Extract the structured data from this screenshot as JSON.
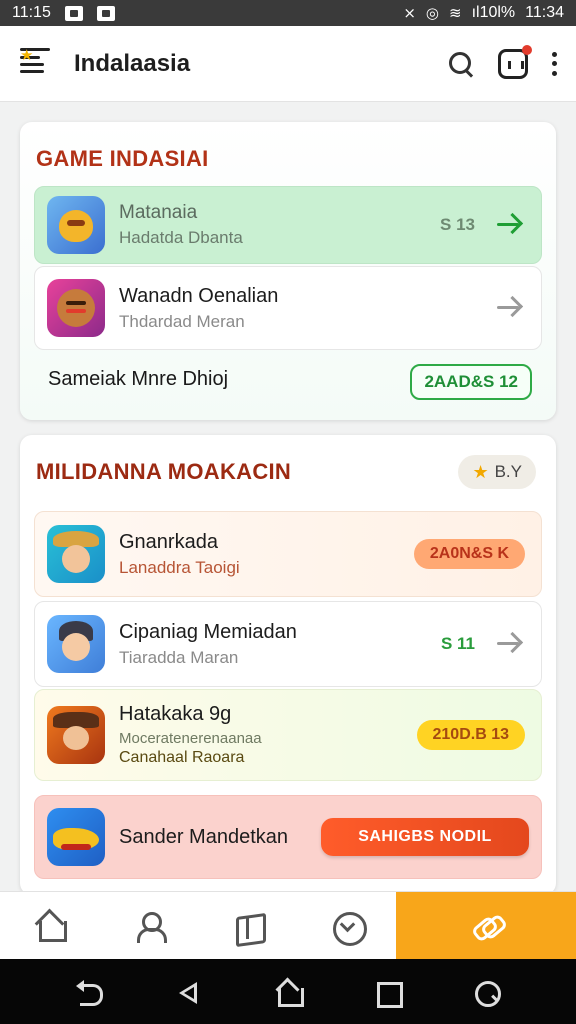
{
  "status_bar": {
    "time_left": "11:15",
    "battery": "ıl10l%",
    "time_right": "11:34"
  },
  "app_bar": {
    "title": "Indalaasia"
  },
  "section_games": {
    "title": "GAME INDASIAI",
    "items": [
      {
        "name": "Matanaia",
        "subtitle": "Hadatda Dbanta",
        "price": "S 13",
        "icon": "dragon-game-icon"
      },
      {
        "name": "Wanadn Oenalian",
        "subtitle": "Thdardad Meran",
        "icon": "cookie-game-icon"
      }
    ],
    "more_label": "Sameiak Mnre Dhioj",
    "more_badge": "2AAD&S 12"
  },
  "section_more": {
    "title": "MILIDANNA MOAKACIN",
    "chip_label": "B.Y",
    "items": [
      {
        "name": "Gnanrkada",
        "subtitle": "Lanaddra Taoigi",
        "pill": "2A0N&S K",
        "pill_color": "#ffa873",
        "icon": "farmer-game-icon"
      },
      {
        "name": "Cipaniag Memiadan",
        "subtitle": "Tiaradda Maran",
        "price": "S 11",
        "icon": "boy-game-icon"
      },
      {
        "name": "Hatakaka 9g",
        "subtitle": "Moceratenerenaanaa",
        "extra": "Canahaal Raoara",
        "pill": "210D.B 13",
        "pill_color": "#ffd323",
        "icon": "cowboy-game-icon"
      }
    ],
    "promo": {
      "label": "Sander Mandetkan",
      "cta": "SAHIGBS NODIL",
      "icon": "croc-game-icon"
    }
  },
  "bottom_nav": [
    {
      "icon": "home-icon",
      "active": false
    },
    {
      "icon": "user-icon",
      "active": false
    },
    {
      "icon": "map-icon",
      "active": false
    },
    {
      "icon": "clock-icon",
      "active": false
    },
    {
      "icon": "link-icon",
      "active": true
    }
  ],
  "colors": {
    "accent": "#f8a61a",
    "title_red": "#b23217",
    "green": "#2eaa46",
    "cta_orange": "#ff5c2a"
  }
}
